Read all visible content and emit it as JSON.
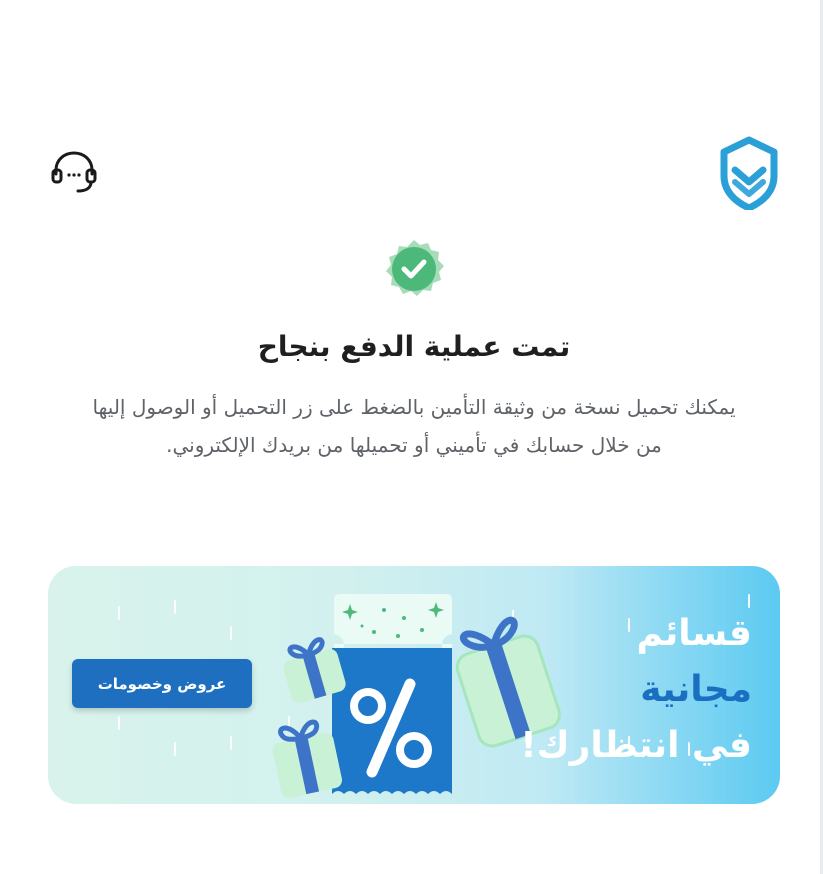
{
  "header": {
    "logo_icon": "shield-check-icon",
    "support_icon": "headset-support-icon"
  },
  "status": {
    "icon": "success-check-badge-icon",
    "title": "تمت عملية الدفع بنجاح",
    "description": "يمكنك تحميل نسخة من وثيقة التأمين بالضغط على زر التحميل أو الوصول إليها من خلال حسابك في تأميني أو تحميلها من بريدك الإلكتروني."
  },
  "banner": {
    "headline_line1": "قسائم",
    "headline_line2": "مجانية",
    "headline_line3": "في انتظارك!",
    "button_label": "عروض وخصومات",
    "ticket_symbol": "%"
  },
  "colors": {
    "brand_blue": "#1e6fc0",
    "logo_blue": "#2a9fd8",
    "success_green": "#4cb97a",
    "banner_gradient_end": "#5ccaf2"
  }
}
